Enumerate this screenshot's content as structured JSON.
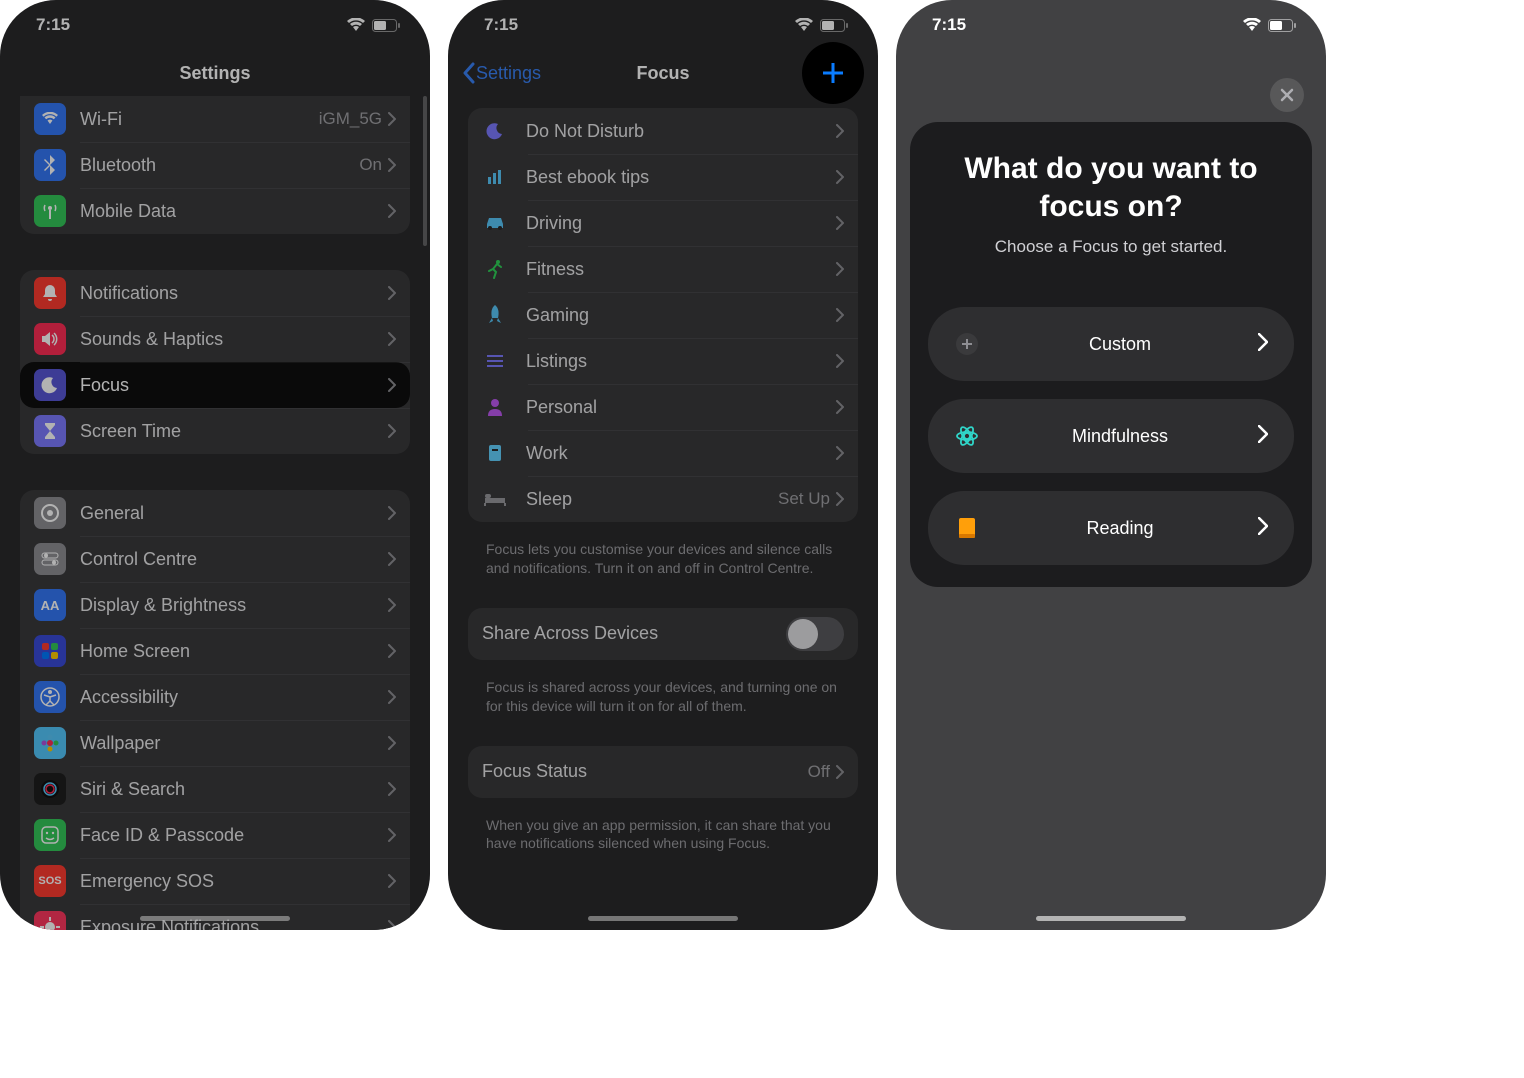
{
  "status": {
    "time": "7:15"
  },
  "phone1": {
    "title": "Settings",
    "group1": [
      {
        "label": "Wi-Fi",
        "value": "iGM_5G",
        "iconColor": "#3478f6",
        "glyph": "wifi"
      },
      {
        "label": "Bluetooth",
        "value": "On",
        "iconColor": "#3478f6",
        "glyph": "bluetooth"
      },
      {
        "label": "Mobile Data",
        "iconColor": "#34c759",
        "glyph": "antenna"
      }
    ],
    "group2": [
      {
        "label": "Notifications",
        "iconColor": "#ff3b30",
        "glyph": "bell"
      },
      {
        "label": "Sounds & Haptics",
        "iconColor": "#ff2d55",
        "glyph": "speaker"
      },
      {
        "label": "Focus",
        "iconColor": "#5856d6",
        "glyph": "moon",
        "highlight": true
      },
      {
        "label": "Screen Time",
        "iconColor": "#7d7aff",
        "glyph": "hourglass"
      }
    ],
    "group3": [
      {
        "label": "General",
        "iconColor": "#8e8e93",
        "glyph": "gear"
      },
      {
        "label": "Control Centre",
        "iconColor": "#8e8e93",
        "glyph": "switches"
      },
      {
        "label": "Display & Brightness",
        "iconColor": "#3478f6",
        "glyph": "AA"
      },
      {
        "label": "Home Screen",
        "iconColor": "#3a4bd8",
        "glyph": "grid"
      },
      {
        "label": "Accessibility",
        "iconColor": "#3478f6",
        "glyph": "access"
      },
      {
        "label": "Wallpaper",
        "iconColor": "#54c7fc",
        "glyph": "flower"
      },
      {
        "label": "Siri & Search",
        "iconColor": "#1f1f1f",
        "glyph": "siri"
      },
      {
        "label": "Face ID & Passcode",
        "iconColor": "#34c759",
        "glyph": "face"
      },
      {
        "label": "Emergency SOS",
        "iconColor": "#ff3b30",
        "glyph": "SOS"
      },
      {
        "label": "Exposure Notifications",
        "iconColor": "#ff375f",
        "glyph": "virus"
      }
    ]
  },
  "phone2": {
    "back": "Settings",
    "title": "Focus",
    "modes": [
      {
        "label": "Do Not Disturb",
        "color": "#7d7aff",
        "glyph": "moon"
      },
      {
        "label": "Best ebook tips",
        "color": "#5ac8fa",
        "glyph": "chart"
      },
      {
        "label": "Driving",
        "color": "#5ac8fa",
        "glyph": "car"
      },
      {
        "label": "Fitness",
        "color": "#30d158",
        "glyph": "runner"
      },
      {
        "label": "Gaming",
        "color": "#5ac8fa",
        "glyph": "rocket"
      },
      {
        "label": "Listings",
        "color": "#7d7aff",
        "glyph": "list"
      },
      {
        "label": "Personal",
        "color": "#bf5af2",
        "glyph": "person"
      },
      {
        "label": "Work",
        "color": "#64d2ff",
        "glyph": "badge"
      },
      {
        "label": "Sleep",
        "color": "#98989d",
        "glyph": "bed",
        "value": "Set Up"
      }
    ],
    "footer1": "Focus lets you customise your devices and silence calls and notifications. Turn it on and off in Control Centre.",
    "share": {
      "label": "Share Across Devices",
      "on": false
    },
    "footer2": "Focus is shared across your devices, and turning one on for this device will turn it on for all of them.",
    "status": {
      "label": "Focus Status",
      "value": "Off"
    },
    "footer3": "When you give an app permission, it can share that you have notifications silenced when using Focus."
  },
  "phone3": {
    "title": "What do you want to focus on?",
    "subtitle": "Choose a Focus to get started.",
    "options": [
      {
        "label": "Custom",
        "glyph": "plus",
        "color": "#8e8e93"
      },
      {
        "label": "Mindfulness",
        "glyph": "mind",
        "color": "#30d5c8"
      },
      {
        "label": "Reading",
        "glyph": "book",
        "color": "#ff9f0a"
      }
    ]
  }
}
